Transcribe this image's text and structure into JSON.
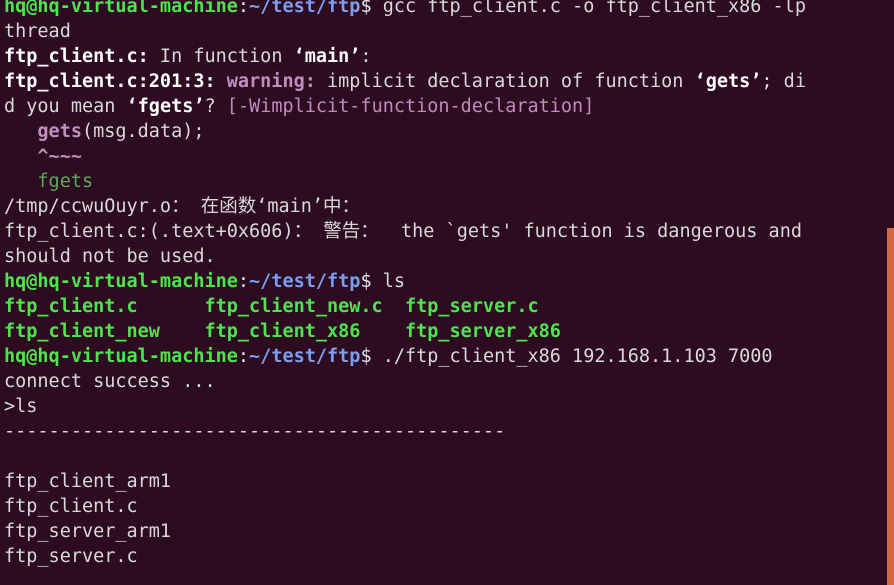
{
  "terminal": {
    "background_color": "#2d0b20",
    "foreground_color": "#d8d8d8",
    "prompt_user_host_color": "#4ee44e",
    "prompt_path_color": "#7b9ef0",
    "warning_color": "#c08fc0",
    "scrollbar_color": "#cf6a40",
    "prompt": {
      "user_host": "hq@hq-virtual-machine",
      "separator": ":",
      "path": "~/test/ftp",
      "sigil": "$"
    },
    "lines": [
      {
        "id": "line-gcc-command",
        "type": "prompt",
        "command": " gcc ftp_client.c -o ftp_client_x86 -lp"
      },
      {
        "id": "line-gcc-command-wrap",
        "type": "plain",
        "text": "thread"
      },
      {
        "id": "line-in-function-main",
        "type": "mixed",
        "parts": [
          {
            "text": "ftp_client.c:",
            "style": "bold"
          },
          {
            "text": " In function ",
            "style": "plain"
          },
          {
            "text": "‘main’",
            "style": "bold"
          },
          {
            "text": ":",
            "style": "plain"
          }
        ]
      },
      {
        "id": "line-warning-implicit-decl",
        "type": "mixed",
        "parts": [
          {
            "text": "ftp_client.c:201:3:",
            "style": "bold"
          },
          {
            "text": " ",
            "style": "plain"
          },
          {
            "text": "warning:",
            "style": "magenta"
          },
          {
            "text": " implicit declaration of function ",
            "style": "plain"
          },
          {
            "text": "‘gets’",
            "style": "bold"
          },
          {
            "text": "; di",
            "style": "plain"
          }
        ]
      },
      {
        "id": "line-warning-wrap",
        "type": "mixed",
        "parts": [
          {
            "text": "d you mean ",
            "style": "plain"
          },
          {
            "text": "‘fgets’",
            "style": "bold"
          },
          {
            "text": "? ",
            "style": "plain"
          },
          {
            "text": "[-Wimplicit-function-declaration]",
            "style": "magenta-normal"
          }
        ]
      },
      {
        "id": "line-source-snippet",
        "type": "mixed",
        "parts": [
          {
            "text": "   ",
            "style": "plain"
          },
          {
            "text": "gets",
            "style": "magenta"
          },
          {
            "text": "(msg.data);",
            "style": "plain"
          }
        ]
      },
      {
        "id": "line-caret-marker",
        "type": "mixed",
        "parts": [
          {
            "text": "   ",
            "style": "plain"
          },
          {
            "text": "^~~~",
            "style": "magenta"
          }
        ]
      },
      {
        "id": "line-fgets-suggestion",
        "type": "mixed",
        "parts": [
          {
            "text": "   ",
            "style": "plain"
          },
          {
            "text": "fgets",
            "style": "lgreen"
          }
        ]
      },
      {
        "id": "line-tmp-object-in-function",
        "type": "plain",
        "text": "/tmp/ccwuOuyr.o： 在函数‘main’中："
      },
      {
        "id": "line-gets-dangerous-warning",
        "type": "plain",
        "text": "ftp_client.c:(.text+0x606)： 警告：  the `gets' function is dangerous and"
      },
      {
        "id": "line-gets-dangerous-warning-wrap",
        "type": "plain",
        "text": "should not be used."
      },
      {
        "id": "line-ls-command",
        "type": "prompt",
        "command": " ls"
      },
      {
        "id": "line-ls-output-row-1",
        "type": "filelist",
        "files": [
          "ftp_client.c",
          "ftp_client_new.c",
          "ftp_server.c"
        ]
      },
      {
        "id": "line-ls-output-row-2",
        "type": "filelist",
        "files": [
          "ftp_client_new",
          "ftp_client_x86",
          "ftp_server_x86"
        ]
      },
      {
        "id": "line-run-client-command",
        "type": "prompt",
        "command": " ./ftp_client_x86 192.168.1.103 7000"
      },
      {
        "id": "line-connect-success",
        "type": "plain",
        "text": "connect success ..."
      },
      {
        "id": "line-remote-ls-input",
        "type": "plain",
        "text": ">ls"
      },
      {
        "id": "line-separator-dashes",
        "type": "plain",
        "text": "---------------------------------------------"
      },
      {
        "id": "line-blank-1",
        "type": "plain",
        "text": ""
      },
      {
        "id": "line-remote-file-1",
        "type": "plain",
        "text": "ftp_client_arm1"
      },
      {
        "id": "line-remote-file-2",
        "type": "plain",
        "text": "ftp_client.c"
      },
      {
        "id": "line-remote-file-3",
        "type": "plain",
        "text": "ftp_server_arm1"
      },
      {
        "id": "line-remote-file-4",
        "type": "plain",
        "text": "ftp_server.c"
      }
    ]
  }
}
